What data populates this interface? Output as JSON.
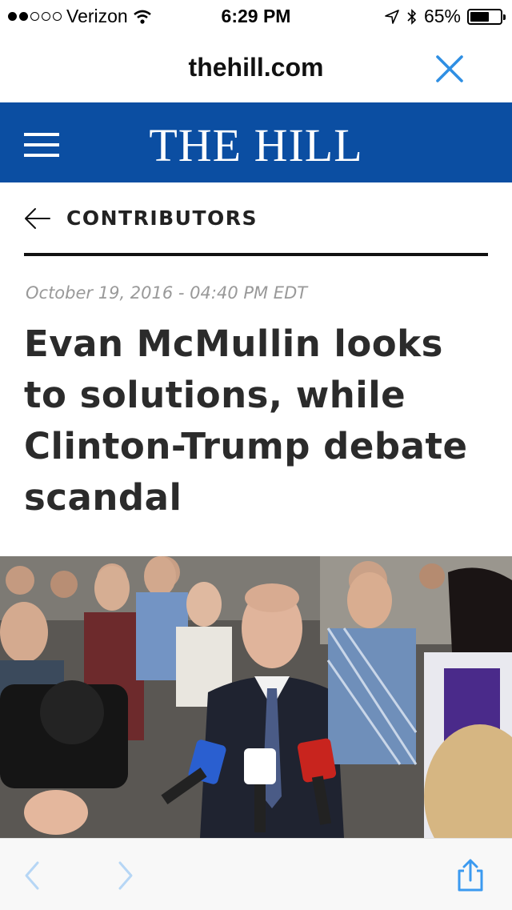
{
  "status_bar": {
    "carrier": "Verizon",
    "signal_strength": 2,
    "time": "6:29 PM",
    "battery": "65%",
    "battery_level": 0.65
  },
  "browser": {
    "url": "thehill.com"
  },
  "site": {
    "logo_text": "THE HILL",
    "brand_color": "#0b4ea2"
  },
  "section": {
    "label": "CONTRIBUTORS"
  },
  "article": {
    "date": "October 19, 2016 - 04:40 PM EDT",
    "title": "Evan McMullin looks to solutions, while Clinton-Trump debate scandal"
  },
  "icons": {
    "status": [
      "wifi-icon",
      "location-icon",
      "bluetooth-icon",
      "battery-icon"
    ],
    "browser": [
      "close-icon"
    ],
    "header": [
      "menu-icon"
    ],
    "nav": [
      "back-arrow-icon"
    ],
    "toolbar": [
      "back-icon",
      "forward-icon",
      "share-icon"
    ]
  },
  "colors": {
    "toolbar_icon": "#3b9af0",
    "close_icon": "#2f8fe3",
    "toolbar_disabled": "#b6d6f5"
  }
}
